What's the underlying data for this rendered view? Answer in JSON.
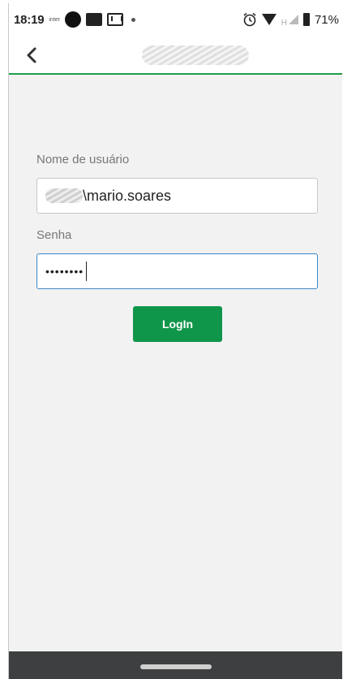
{
  "status_bar": {
    "time": "18:19",
    "carrier": "inter",
    "battery": "71%",
    "network": "H"
  },
  "app_bar": {
    "back_icon": "chevron-left-icon",
    "accent_color": "#1e9e4a"
  },
  "login_form": {
    "username_label": "Nome de usuário",
    "username_value": "\\mario.soares",
    "password_label": "Senha",
    "password_value": "••••••••",
    "login_button": "LogIn",
    "button_color": "#10964a"
  }
}
